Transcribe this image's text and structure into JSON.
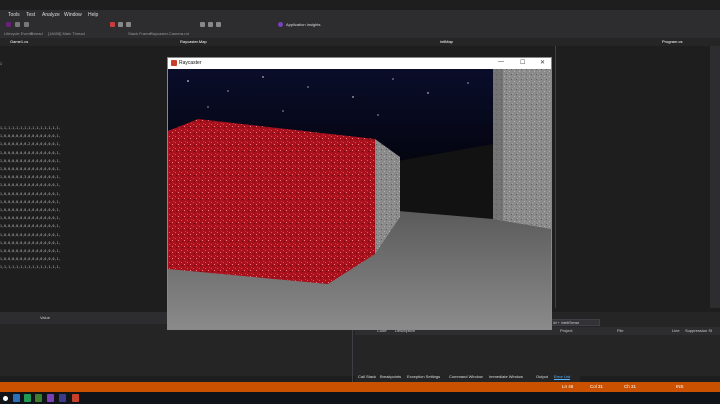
{
  "menu": {
    "items": [
      "Tools",
      "Test",
      "Analyze",
      "Window",
      "Help"
    ]
  },
  "toolbar": {
    "app_insights": "Application Insights",
    "lifecycle": "Lifecycle Events",
    "thread": "Thread",
    "main_thread": "[18408] Main Thread",
    "stack_frame": "Stack Frame:",
    "stack_value": "Raycaster.Camera.rot"
  },
  "tabs": {
    "left": "Game1.cs",
    "middle_left": "Raycaster.Map",
    "middle_right": "initMap",
    "right": "Program.cs"
  },
  "code": {
    "lines": [
      "1,1,1,1,1,1,1,1,1,1,1,1,1,1,1,",
      "1,0,0,0,0,0,0,0,0,0,0,0,0,0,1,",
      "1,0,0,0,0,0,0,2,0,0,0,0,0,0,1,",
      "1,0,0,0,0,0,0,0,0,0,0,0,0,0,1,",
      "1,0,0,0,0,0,0,0,0,0,0,0,0,0,1,",
      "1,0,0,0,0,0,0,0,0,0,0,0,0,0,1,",
      "1,0,0,0,0,0,3,0,0,0,0,0,0,0,1,",
      "1,0,0,0,0,0,0,0,0,0,0,0,0,0,1,",
      "1,0,0,0,0,0,0,0,0,0,0,0,0,0,1,",
      "1,0,0,0,0,0,0,0,0,0,0,0,0,0,1,",
      "1,0,0,0,0,0,0,4,0,0,0,0,0,0,1,",
      "1,0,0,0,0,0,0,0,0,0,0,0,0,0,1,",
      "1,0,0,0,0,0,0,0,0,0,0,0,0,0,1,",
      "1,0,0,0,0,0,0,0,0,0,0,0,0,0,1,",
      "1,0,0,0,0,0,0,0,0,0,0,0,0,0,1,",
      "1,0,0,0,0,0,0,0,0,0,0,0,0,0,1,",
      "1,0,0,0,0,0,0,0,0,0,0,0,0,0,1,",
      "1,1,1,1,1,1,1,1,1,1,1,1,1,1,1,"
    ]
  },
  "window": {
    "title": "Raycaster",
    "minimize": "—",
    "maximize": "☐",
    "close": "✕"
  },
  "panel": {
    "value_header": "Value",
    "code_header": "Code",
    "description_header": "Description",
    "project_header": "Project",
    "file_header": "File",
    "line_header": "Line",
    "suppression_header": "Suppression St",
    "build_filter": "ild + IntelliSense"
  },
  "bottom_tabs": [
    "Call Stack",
    "Breakpoints",
    "Exception Settings",
    "Command Window",
    "Immediate Window",
    "Output",
    "Error List"
  ],
  "status": {
    "ln": "Ln 46",
    "col": "Col 31",
    "ch": "Ch 31",
    "ins": "INS"
  },
  "colors": {
    "accent": "#ca5100",
    "red_wall": "#b0121e"
  }
}
